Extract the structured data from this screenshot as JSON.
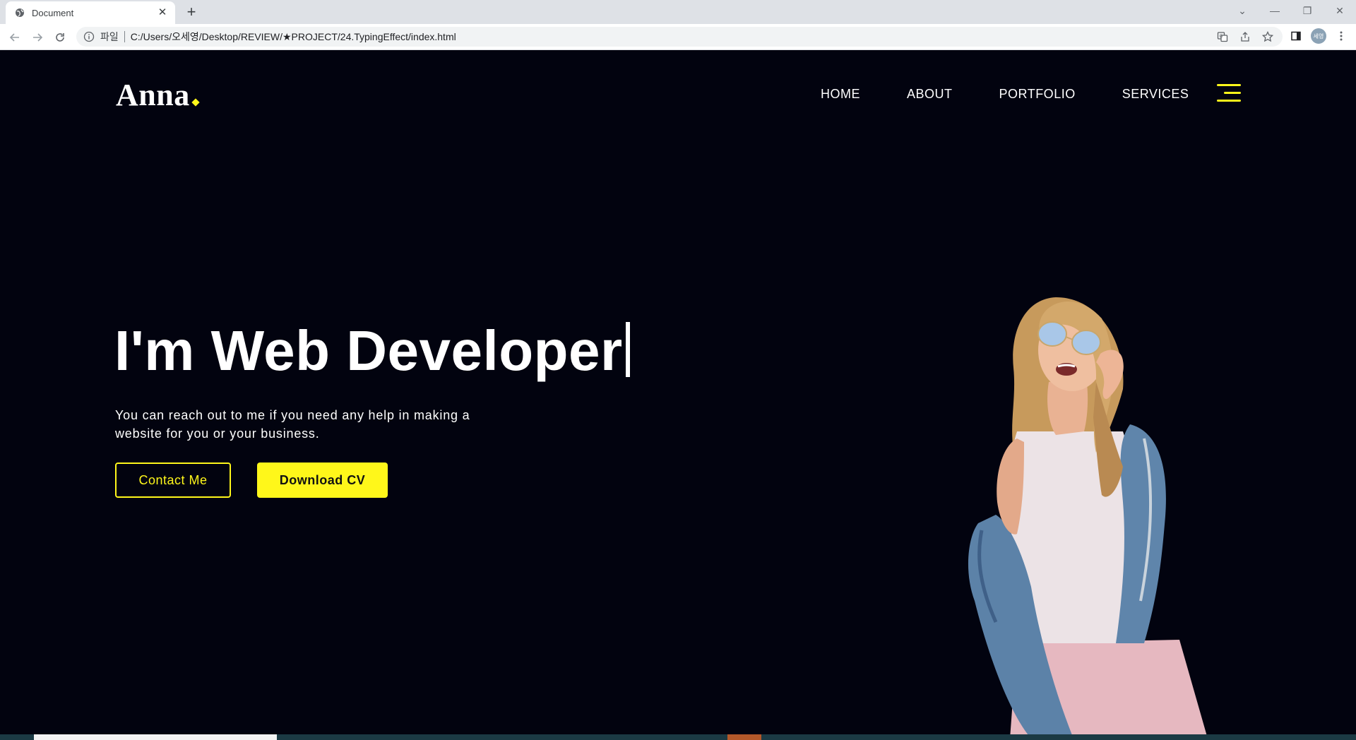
{
  "browser": {
    "tab_title": "Document",
    "new_tab": "+",
    "close_tab": "✕",
    "scheme_label": "파일",
    "url": "C:/Users/오세영/Desktop/REVIEW/★PROJECT/24.TypingEffect/index.html",
    "profile_initials": "세영",
    "window_controls": {
      "dropdown": "⌄",
      "minimize": "—",
      "restore": "❐",
      "close": "✕"
    }
  },
  "site": {
    "logo": "Anna",
    "accent_color": "#fff71a",
    "background_color": "#02030f",
    "nav": [
      {
        "label": "HOME"
      },
      {
        "label": "ABOUT"
      },
      {
        "label": "PORTFOLIO"
      },
      {
        "label": "SERVICES"
      }
    ]
  },
  "hero": {
    "headline": "I'm Web Developer",
    "description": "You can reach out to me if you need any help in making a website for you or your business.",
    "contact_button": "Contact Me",
    "download_button": "Download CV"
  }
}
